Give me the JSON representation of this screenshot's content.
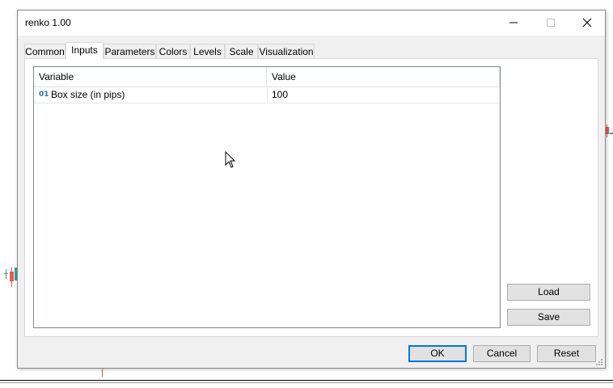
{
  "window": {
    "title": "renko 1.00",
    "controls": {
      "minimize": "minimize-icon",
      "maximize": "maximize-icon",
      "close": "close-icon"
    }
  },
  "tabs": [
    {
      "label": "Common",
      "active": false
    },
    {
      "label": "Inputs",
      "active": true
    },
    {
      "label": "Parameters",
      "active": false
    },
    {
      "label": "Colors",
      "active": false
    },
    {
      "label": "Levels",
      "active": false
    },
    {
      "label": "Scale",
      "active": false
    },
    {
      "label": "Visualization",
      "active": false
    }
  ],
  "inputs_table": {
    "columns": [
      "Variable",
      "Value"
    ],
    "rows": [
      {
        "type_icon": "01",
        "variable": "Box size (in pips)",
        "value": "100"
      }
    ]
  },
  "side_buttons": {
    "load": "Load",
    "save": "Save"
  },
  "footer_buttons": {
    "ok": "OK",
    "cancel": "Cancel",
    "reset": "Reset"
  },
  "colors": {
    "accent": "#0078d7",
    "bull_candle": "#26a69a",
    "bear_candle": "#ef5350"
  }
}
